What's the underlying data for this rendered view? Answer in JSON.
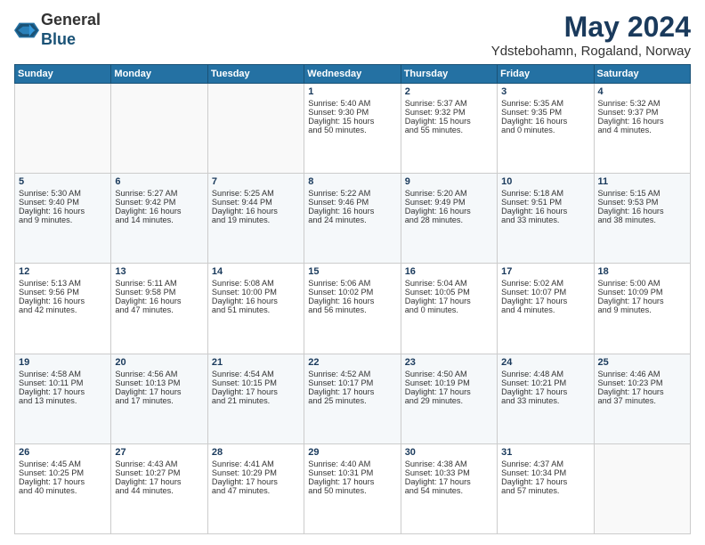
{
  "logo": {
    "general": "General",
    "blue": "Blue"
  },
  "title": "May 2024",
  "location": "Ydstebohamn, Rogaland, Norway",
  "days_of_week": [
    "Sunday",
    "Monday",
    "Tuesday",
    "Wednesday",
    "Thursday",
    "Friday",
    "Saturday"
  ],
  "weeks": [
    [
      {
        "day": "",
        "info": ""
      },
      {
        "day": "",
        "info": ""
      },
      {
        "day": "",
        "info": ""
      },
      {
        "day": "1",
        "info": "Sunrise: 5:40 AM\nSunset: 9:30 PM\nDaylight: 15 hours\nand 50 minutes."
      },
      {
        "day": "2",
        "info": "Sunrise: 5:37 AM\nSunset: 9:32 PM\nDaylight: 15 hours\nand 55 minutes."
      },
      {
        "day": "3",
        "info": "Sunrise: 5:35 AM\nSunset: 9:35 PM\nDaylight: 16 hours\nand 0 minutes."
      },
      {
        "day": "4",
        "info": "Sunrise: 5:32 AM\nSunset: 9:37 PM\nDaylight: 16 hours\nand 4 minutes."
      }
    ],
    [
      {
        "day": "5",
        "info": "Sunrise: 5:30 AM\nSunset: 9:40 PM\nDaylight: 16 hours\nand 9 minutes."
      },
      {
        "day": "6",
        "info": "Sunrise: 5:27 AM\nSunset: 9:42 PM\nDaylight: 16 hours\nand 14 minutes."
      },
      {
        "day": "7",
        "info": "Sunrise: 5:25 AM\nSunset: 9:44 PM\nDaylight: 16 hours\nand 19 minutes."
      },
      {
        "day": "8",
        "info": "Sunrise: 5:22 AM\nSunset: 9:46 PM\nDaylight: 16 hours\nand 24 minutes."
      },
      {
        "day": "9",
        "info": "Sunrise: 5:20 AM\nSunset: 9:49 PM\nDaylight: 16 hours\nand 28 minutes."
      },
      {
        "day": "10",
        "info": "Sunrise: 5:18 AM\nSunset: 9:51 PM\nDaylight: 16 hours\nand 33 minutes."
      },
      {
        "day": "11",
        "info": "Sunrise: 5:15 AM\nSunset: 9:53 PM\nDaylight: 16 hours\nand 38 minutes."
      }
    ],
    [
      {
        "day": "12",
        "info": "Sunrise: 5:13 AM\nSunset: 9:56 PM\nDaylight: 16 hours\nand 42 minutes."
      },
      {
        "day": "13",
        "info": "Sunrise: 5:11 AM\nSunset: 9:58 PM\nDaylight: 16 hours\nand 47 minutes."
      },
      {
        "day": "14",
        "info": "Sunrise: 5:08 AM\nSunset: 10:00 PM\nDaylight: 16 hours\nand 51 minutes."
      },
      {
        "day": "15",
        "info": "Sunrise: 5:06 AM\nSunset: 10:02 PM\nDaylight: 16 hours\nand 56 minutes."
      },
      {
        "day": "16",
        "info": "Sunrise: 5:04 AM\nSunset: 10:05 PM\nDaylight: 17 hours\nand 0 minutes."
      },
      {
        "day": "17",
        "info": "Sunrise: 5:02 AM\nSunset: 10:07 PM\nDaylight: 17 hours\nand 4 minutes."
      },
      {
        "day": "18",
        "info": "Sunrise: 5:00 AM\nSunset: 10:09 PM\nDaylight: 17 hours\nand 9 minutes."
      }
    ],
    [
      {
        "day": "19",
        "info": "Sunrise: 4:58 AM\nSunset: 10:11 PM\nDaylight: 17 hours\nand 13 minutes."
      },
      {
        "day": "20",
        "info": "Sunrise: 4:56 AM\nSunset: 10:13 PM\nDaylight: 17 hours\nand 17 minutes."
      },
      {
        "day": "21",
        "info": "Sunrise: 4:54 AM\nSunset: 10:15 PM\nDaylight: 17 hours\nand 21 minutes."
      },
      {
        "day": "22",
        "info": "Sunrise: 4:52 AM\nSunset: 10:17 PM\nDaylight: 17 hours\nand 25 minutes."
      },
      {
        "day": "23",
        "info": "Sunrise: 4:50 AM\nSunset: 10:19 PM\nDaylight: 17 hours\nand 29 minutes."
      },
      {
        "day": "24",
        "info": "Sunrise: 4:48 AM\nSunset: 10:21 PM\nDaylight: 17 hours\nand 33 minutes."
      },
      {
        "day": "25",
        "info": "Sunrise: 4:46 AM\nSunset: 10:23 PM\nDaylight: 17 hours\nand 37 minutes."
      }
    ],
    [
      {
        "day": "26",
        "info": "Sunrise: 4:45 AM\nSunset: 10:25 PM\nDaylight: 17 hours\nand 40 minutes."
      },
      {
        "day": "27",
        "info": "Sunrise: 4:43 AM\nSunset: 10:27 PM\nDaylight: 17 hours\nand 44 minutes."
      },
      {
        "day": "28",
        "info": "Sunrise: 4:41 AM\nSunset: 10:29 PM\nDaylight: 17 hours\nand 47 minutes."
      },
      {
        "day": "29",
        "info": "Sunrise: 4:40 AM\nSunset: 10:31 PM\nDaylight: 17 hours\nand 50 minutes."
      },
      {
        "day": "30",
        "info": "Sunrise: 4:38 AM\nSunset: 10:33 PM\nDaylight: 17 hours\nand 54 minutes."
      },
      {
        "day": "31",
        "info": "Sunrise: 4:37 AM\nSunset: 10:34 PM\nDaylight: 17 hours\nand 57 minutes."
      },
      {
        "day": "",
        "info": ""
      }
    ]
  ]
}
